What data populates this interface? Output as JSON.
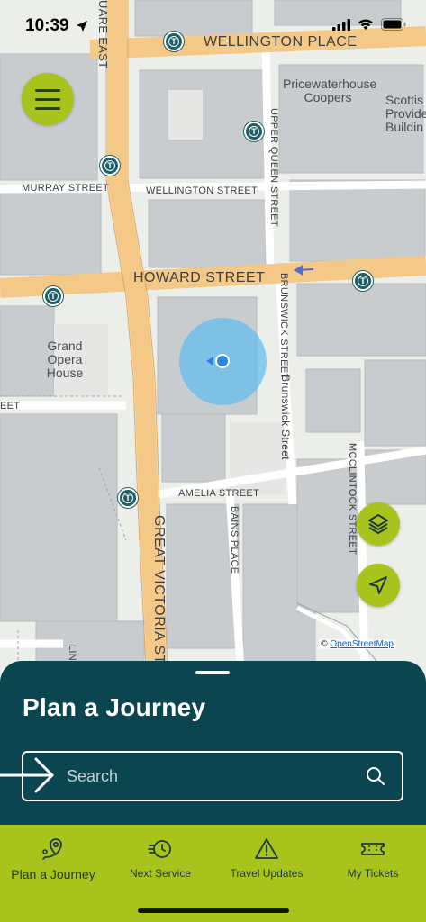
{
  "status_bar": {
    "time": "10:39"
  },
  "map": {
    "streets": {
      "wellington_place": "WELLINGTON PLACE",
      "wellington_street": "WELLINGTON STREET",
      "murray_street": "MURRAY STREET",
      "howard_street": "HOWARD STREET",
      "upper_queen_street": "UPPER QUEEN STREET",
      "brunswick_street_caps": "BRUNSWICK STREET",
      "brunswick_street": "Brunswick Street",
      "amelia_street": "AMELIA STREET",
      "bains_place": "BAINS PLACE",
      "mcclintock_street": "MCCLINTOCK STREET",
      "great_victoria_street": "GREAT VICTORIA ST",
      "square_east": "UARE EAST",
      "linco": "LINCO",
      "eet": "EET"
    },
    "pois": {
      "pwc_line1": "Pricewaterhouse",
      "pwc_line2": "Coopers",
      "scottish_line1": "Scottis",
      "scottish_line2": "Provide",
      "scottish_line3": "Buildin",
      "opera_line1": "Grand",
      "opera_line2": "Opera",
      "opera_line3": "House"
    },
    "transit_stop_letter": "T",
    "attribution_prefix": "©",
    "attribution_link": "OpenStreetMap"
  },
  "sheet": {
    "title": "Plan a Journey",
    "search_placeholder": "Search"
  },
  "tabs": [
    {
      "label": "Plan a Journey",
      "icon": "map-pin-route-icon",
      "active": true
    },
    {
      "label": "Next Service",
      "icon": "fast-clock-icon",
      "active": false
    },
    {
      "label": "Travel Updates",
      "icon": "warning-triangle-icon",
      "active": false
    },
    {
      "label": "My Tickets",
      "icon": "ticket-icon",
      "active": false
    }
  ],
  "colors": {
    "accent": "#a8c31c",
    "sheet": "#0b4650",
    "transit_pin": "#1f5f66",
    "location": "#2c86de",
    "main_road": "#f4c987"
  }
}
